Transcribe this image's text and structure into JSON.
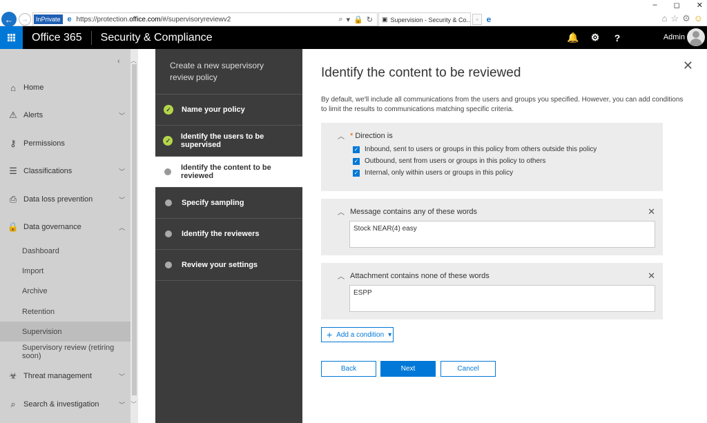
{
  "browser": {
    "inprivate_label": "InPrivate",
    "url_prefix": "https://protection.",
    "url_domain": "office.com",
    "url_path": "/#/supervisoryreviewv2",
    "tab_title": "Supervision - Security & Co...",
    "win_minimize": "–",
    "win_maximize": "◻",
    "win_close": "✕"
  },
  "header": {
    "brand": "Office 365",
    "app_name": "Security & Compliance",
    "user_name": "Admin",
    "bell_icon": "🔔",
    "gear_icon": "⚙",
    "help_icon": "?"
  },
  "leftnav": {
    "items": [
      {
        "label": "Home",
        "icon": "⌂",
        "icon_name": "home-icon"
      },
      {
        "label": "Alerts",
        "icon": "⚠",
        "icon_name": "alert-icon"
      },
      {
        "label": "Permissions",
        "icon": "⚷",
        "icon_name": "permissions-icon"
      },
      {
        "label": "Classifications",
        "icon": "☰",
        "icon_name": "classifications-icon"
      },
      {
        "label": "Data loss prevention",
        "icon": "⎙",
        "icon_name": "dlp-icon"
      },
      {
        "label": "Data governance",
        "icon": "🔒",
        "icon_name": "lock-icon"
      },
      {
        "label": "Threat management",
        "icon": "☣",
        "icon_name": "biohazard-icon"
      },
      {
        "label": "Search & investigation",
        "icon": "⌕",
        "icon_name": "search-icon"
      }
    ],
    "sub_items": [
      "Dashboard",
      "Import",
      "Archive",
      "Retention",
      "Supervision",
      "Supervisory review (retiring soon)"
    ]
  },
  "wizard": {
    "title": "Create a new supervisory review policy",
    "steps": [
      {
        "label": "Name your policy",
        "status": "done"
      },
      {
        "label": "Identify the users to be supervised",
        "status": "done"
      },
      {
        "label": "Identify the content to be reviewed",
        "status": "current"
      },
      {
        "label": "Specify sampling",
        "status": "todo"
      },
      {
        "label": "Identify the reviewers",
        "status": "todo"
      },
      {
        "label": "Review your settings",
        "status": "todo"
      }
    ]
  },
  "main": {
    "title": "Identify the content to be reviewed",
    "description": "By default, we'll include all communications from the users and groups you specified. However, you can add conditions to limit the results to communications matching specific criteria.",
    "direction": {
      "required_mark": "*",
      "label": "Direction is",
      "options": [
        {
          "label": "Inbound, sent to users or groups in this policy from others outside this policy",
          "checked": true
        },
        {
          "label": "Outbound, sent from users or groups in this policy to others",
          "checked": true
        },
        {
          "label": "Internal, only within users or groups in this policy",
          "checked": true
        }
      ]
    },
    "message_condition": {
      "label": "Message contains any of these words",
      "value": "Stock NEAR(4) easy"
    },
    "attachment_condition": {
      "label": "Attachment contains none of these words",
      "value": "ESPP"
    },
    "add_condition_label": "Add a condition",
    "buttons": {
      "back": "Back",
      "next": "Next",
      "cancel": "Cancel"
    }
  },
  "colors": {
    "accent": "#0078d7",
    "done_step": "#b5d64a",
    "wizard_bg": "#3c3c3c",
    "nav_bg": "#d0d0d0"
  }
}
